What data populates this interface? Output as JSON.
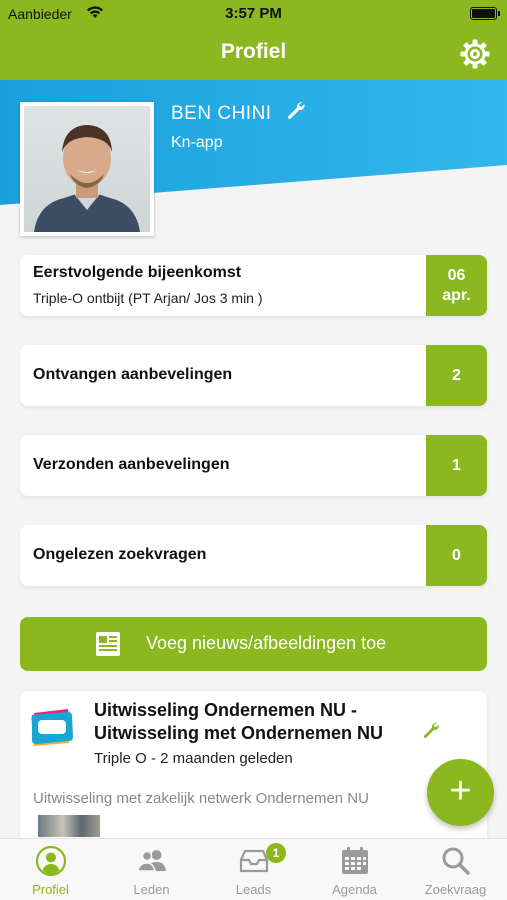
{
  "status_bar": {
    "carrier": "Aanbieder",
    "time": "3:57 PM"
  },
  "nav": {
    "title": "Profiel"
  },
  "profile": {
    "name": "BEN CHINI",
    "subtitle": "Kn-app"
  },
  "cards": {
    "next_meeting": {
      "label": "Eerstvolgende bijeenkomst",
      "sub": "Triple-O ontbijt (PT Arjan/ Jos 3 min )",
      "day": "06",
      "month": "apr."
    },
    "received": {
      "label": "Ontvangen aanbevelingen",
      "count": "2"
    },
    "sent": {
      "label": "Verzonden aanbevelingen",
      "count": "1"
    },
    "unread": {
      "label": "Ongelezen zoekvragen",
      "count": "0"
    }
  },
  "add_news": {
    "label": "Voeg nieuws/afbeeldingen toe"
  },
  "news": {
    "title": "Uitwisseling Ondernemen NU - Uitwisseling met Ondernemen NU",
    "meta": "Triple O - 2 maanden geleden",
    "snippet": "Uitwisseling met zakelijk netwerk Ondernemen NU"
  },
  "fab": {
    "symbol": "+"
  },
  "tabs": [
    {
      "label": "Profiel",
      "icon": "profile-icon",
      "active": true
    },
    {
      "label": "Leden",
      "icon": "members-icon"
    },
    {
      "label": "Leads",
      "icon": "leads-inbox-icon",
      "badge": "1"
    },
    {
      "label": "Agenda",
      "icon": "calendar-icon"
    },
    {
      "label": "Zoekvraag",
      "icon": "search-icon"
    }
  ],
  "colors": {
    "green": "#8ab81e",
    "blue": "#1aa0dc"
  }
}
